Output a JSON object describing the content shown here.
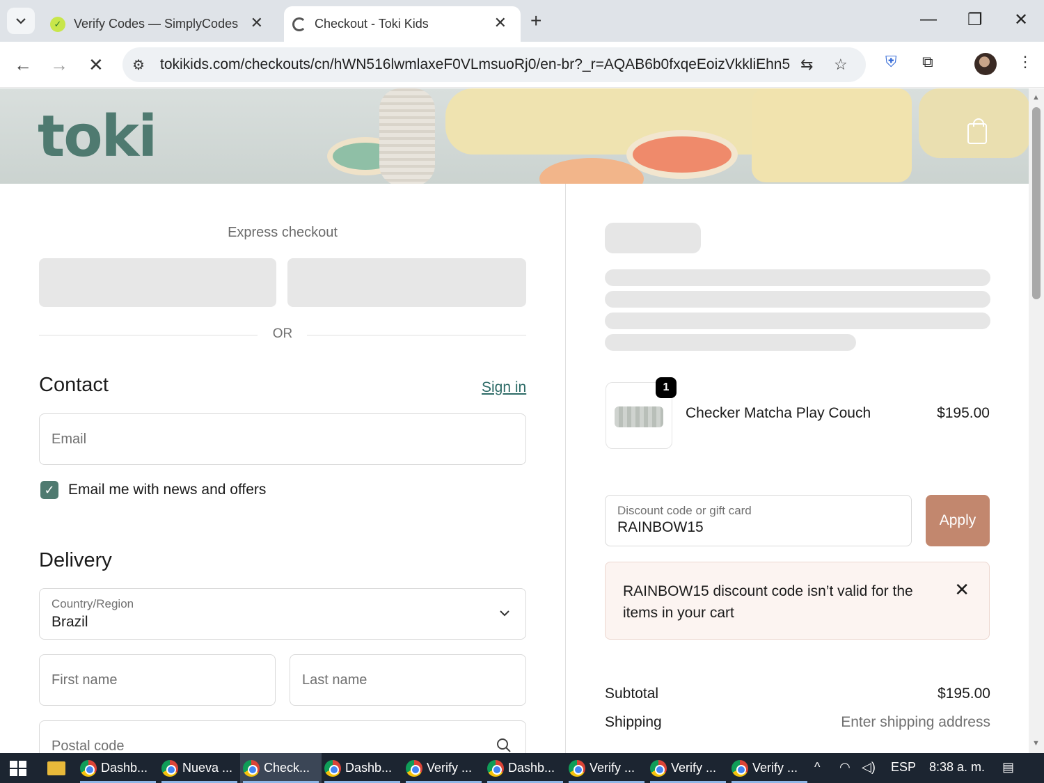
{
  "browser": {
    "tabs": [
      {
        "title": "Verify Codes — SimplyCodes",
        "active": false
      },
      {
        "title": "Checkout - Toki Kids",
        "active": true
      }
    ],
    "url": "tokikids.com/checkouts/cn/hWN516lwmlaxeF0VLmsuoRj0/en-br?_r=AQAB6b0fxqeEoizVkkliEhn5l6..."
  },
  "store": {
    "logo": "toki"
  },
  "checkout": {
    "express_title": "Express checkout",
    "or_label": "OR",
    "contact": {
      "heading": "Contact",
      "sign_in": "Sign in",
      "email_placeholder": "Email",
      "newsletter_label": "Email me with news and offers",
      "newsletter_checked": true
    },
    "delivery": {
      "heading": "Delivery",
      "country_label": "Country/Region",
      "country_value": "Brazil",
      "first_name_placeholder": "First name",
      "last_name_placeholder": "Last name",
      "postal_code_placeholder": "Postal code"
    }
  },
  "order": {
    "item": {
      "name": "Checker Matcha Play Couch",
      "price": "$195.00",
      "quantity": "1"
    },
    "discount": {
      "label": "Discount code or gift card",
      "value": "RAINBOW15",
      "apply_label": "Apply",
      "error": "RAINBOW15 discount code isn’t valid for the items in your cart"
    },
    "summary": {
      "subtotal_label": "Subtotal",
      "subtotal_value": "$195.00",
      "shipping_label": "Shipping",
      "shipping_value": "Enter shipping address"
    }
  },
  "taskbar": {
    "apps": [
      {
        "label": "Dashb...",
        "active": false
      },
      {
        "label": "Nueva ...",
        "active": false
      },
      {
        "label": "Check...",
        "active": true
      },
      {
        "label": "Dashb...",
        "active": false
      },
      {
        "label": "Verify ...",
        "active": false
      },
      {
        "label": "Dashb...",
        "active": false
      },
      {
        "label": "Verify ...",
        "active": false
      },
      {
        "label": "Verify ...",
        "active": false
      },
      {
        "label": "Verify ...",
        "active": false
      }
    ],
    "language": "ESP",
    "time": "8:38 a. m."
  },
  "colors": {
    "brand": "#4f7a70",
    "apply_button": "#c2876e",
    "error_bg": "#fcf4f1"
  }
}
